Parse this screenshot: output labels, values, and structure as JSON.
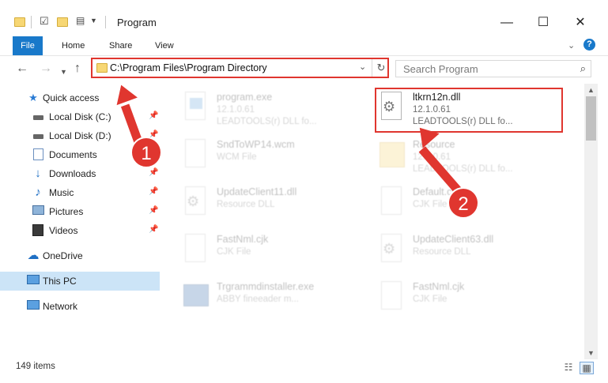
{
  "window": {
    "title": "Program"
  },
  "titlebar": {
    "minimize_glyph": "—",
    "maximize_glyph": "☐",
    "close_glyph": "✕"
  },
  "ribbon": {
    "tabs": [
      "File",
      "Home",
      "Share",
      "View"
    ]
  },
  "address": {
    "path": "C:\\Program Files\\Program Directory"
  },
  "search": {
    "placeholder": "Search Program"
  },
  "sidebar": {
    "items": [
      {
        "label": "Quick access",
        "icon": "star-icon"
      },
      {
        "label": "Local Disk (C:)",
        "icon": "drive-icon"
      },
      {
        "label": "Local Disk (D:)",
        "icon": "drive-icon"
      },
      {
        "label": "Documents",
        "icon": "documents-icon"
      },
      {
        "label": "Downloads",
        "icon": "download-icon"
      },
      {
        "label": "Music",
        "icon": "music-icon"
      },
      {
        "label": "Pictures",
        "icon": "pictures-icon"
      },
      {
        "label": "Videos",
        "icon": "videos-icon"
      },
      {
        "label": "OneDrive",
        "icon": "cloud-icon"
      },
      {
        "label": "This PC",
        "icon": "computer-icon"
      },
      {
        "label": "Network",
        "icon": "network-icon"
      }
    ]
  },
  "files": [
    {
      "name": "program.exe",
      "line2": "12.1.0.61",
      "line3": "LEADTOOLS(r) DLL fo..."
    },
    {
      "name": "ltkrn12n.dll",
      "line2": "12.1.0.61",
      "line3": "LEADTOOLS(r) DLL fo..."
    },
    {
      "name": "SndToWP14.wcm",
      "line2": "WCM File",
      "line3": ""
    },
    {
      "name": "Resource",
      "line2": "12.1.0.61",
      "line3": "LEADTOOLS(r) DLL fo..."
    },
    {
      "name": "UpdateClient11.dll",
      "line2": "Resource DLL",
      "line3": ""
    },
    {
      "name": "Default.cjk",
      "line2": "CJK File",
      "line3": ""
    },
    {
      "name": "FastNml.cjk",
      "line2": "CJK File",
      "line3": ""
    },
    {
      "name": "UpdateClient63.dll",
      "line2": "Resource DLL",
      "line3": ""
    },
    {
      "name": "Trgrammdinstaller.exe",
      "line2": "ABBY fineeader m...",
      "line3": ""
    },
    {
      "name": "FastNml.cjk",
      "line2": "CJK File",
      "line3": ""
    }
  ],
  "status": {
    "item_count": "149 items"
  },
  "callouts": [
    "1",
    "2"
  ],
  "colors": {
    "accent": "#1979ca",
    "callout": "#e0362f",
    "selection": "#cce4f7"
  }
}
